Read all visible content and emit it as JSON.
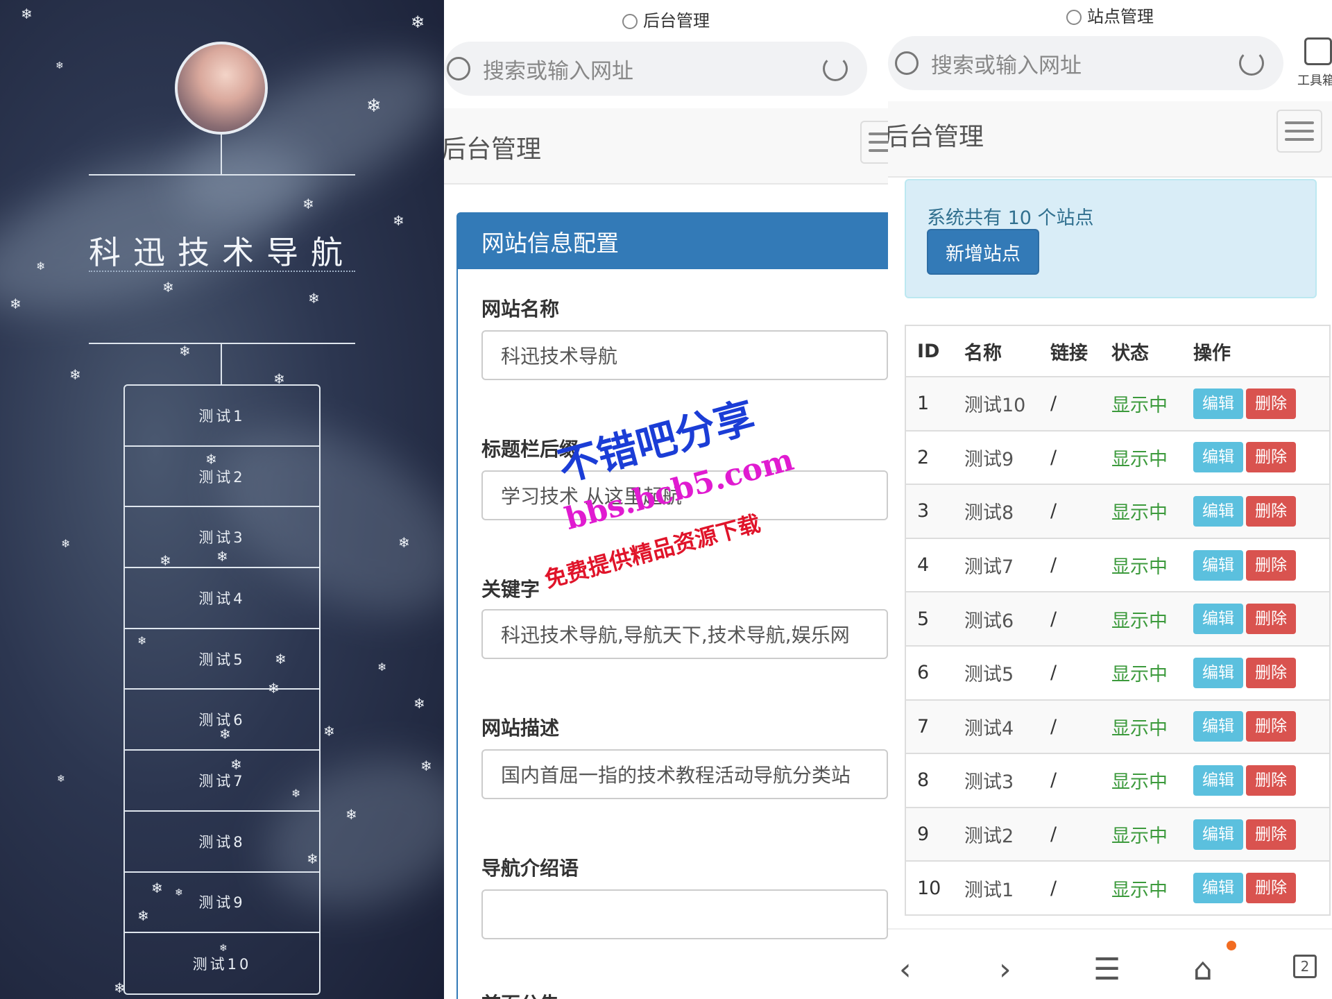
{
  "left_panel": {
    "title": "科迅技术导航",
    "nav_items": [
      "测试1",
      "测试2",
      "测试3",
      "测试4",
      "测试5",
      "测试6",
      "测试7",
      "测试8",
      "测试9",
      "测试10"
    ]
  },
  "middle_panel": {
    "tab_title": "后台管理",
    "address_placeholder": "搜索或输入网址",
    "brand": "后台管理",
    "card_title": "网站信息配置",
    "fields": [
      {
        "label": "网站名称",
        "value": "科迅技术导航"
      },
      {
        "label": "标题栏后缀",
        "value": "学习技术 从这里起航"
      },
      {
        "label": "关键字",
        "value": "科迅技术导航,导航天下,技术导航,娱乐网"
      },
      {
        "label": "网站描述",
        "value": "国内首屈一指的技术教程活动导航分类站"
      },
      {
        "label": "导航介绍语",
        "value": ""
      },
      {
        "label": "首页公告",
        "value": ""
      }
    ],
    "watermark": {
      "line1": "不错吧分享",
      "line2": "bbs.bcb5.com",
      "line3": "免费提供精品资源下载"
    }
  },
  "right_panel": {
    "tab_title": "站点管理",
    "address_placeholder": "搜索或输入网址",
    "toolbox_label": "工具箱",
    "brand": "后台管理",
    "alert_text": "系统共有 10 个站点",
    "add_button": "新增站点",
    "table": {
      "headers": [
        "ID",
        "名称",
        "链接",
        "状态",
        "操作"
      ],
      "rows": [
        {
          "id": "1",
          "name": "测试10",
          "link": "/",
          "status": "显示中"
        },
        {
          "id": "2",
          "name": "测试9",
          "link": "/",
          "status": "显示中"
        },
        {
          "id": "3",
          "name": "测试8",
          "link": "/",
          "status": "显示中"
        },
        {
          "id": "4",
          "name": "测试7",
          "link": "/",
          "status": "显示中"
        },
        {
          "id": "5",
          "name": "测试6",
          "link": "/",
          "status": "显示中"
        },
        {
          "id": "6",
          "name": "测试5",
          "link": "/",
          "status": "显示中"
        },
        {
          "id": "7",
          "name": "测试4",
          "link": "/",
          "status": "显示中"
        },
        {
          "id": "8",
          "name": "测试3",
          "link": "/",
          "status": "显示中"
        },
        {
          "id": "9",
          "name": "测试2",
          "link": "/",
          "status": "显示中"
        },
        {
          "id": "10",
          "name": "测试1",
          "link": "/",
          "status": "显示中"
        }
      ],
      "edit_label": "编辑",
      "delete_label": "删除"
    },
    "bottom_bar": {
      "tab_count": "2"
    }
  },
  "colors": {
    "primary": "#337ab7",
    "info": "#5bc0de",
    "danger": "#d9534f",
    "success_text": "#3c9a3c",
    "alert_bg": "#d9edf7"
  }
}
